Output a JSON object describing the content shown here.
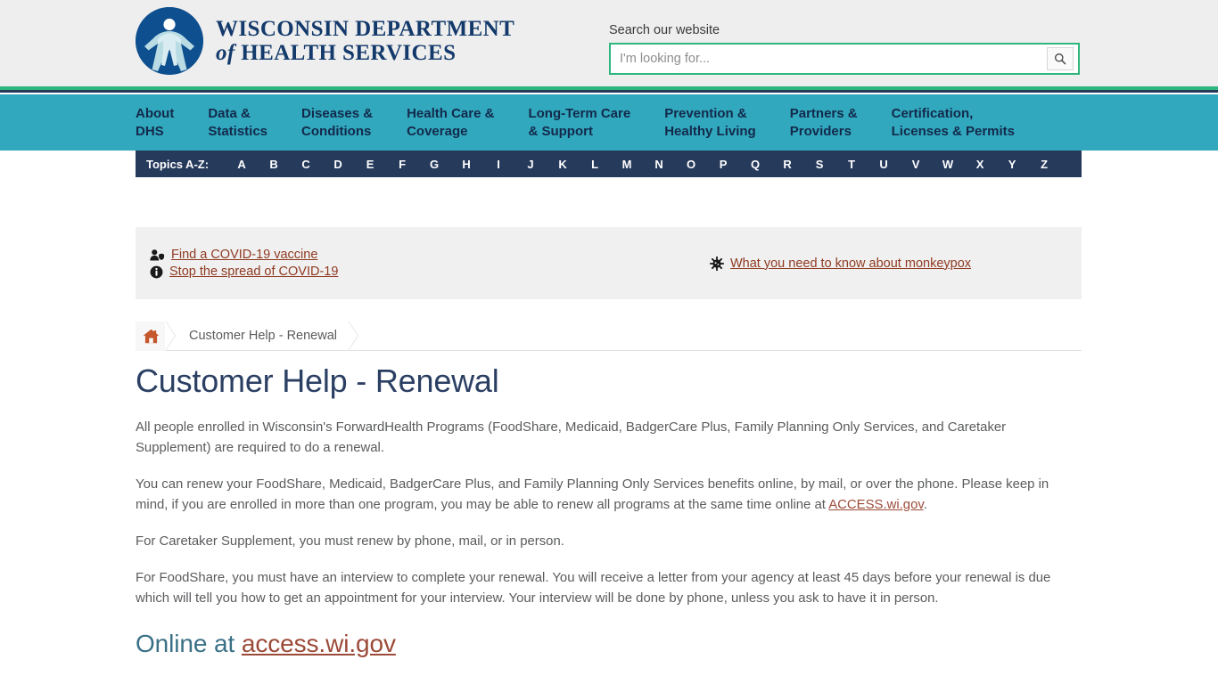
{
  "header": {
    "logo_alt": "Wisconsin Department of Health Services logo",
    "brand_line1": "WISCONSIN DEPARTMENT",
    "brand_of": "of",
    "brand_line2": "HEALTH SERVICES",
    "accent_green": "#2eb67d",
    "brand_navy": "#133a6b"
  },
  "search": {
    "label": "Search our website",
    "placeholder": "I'm looking for...",
    "value": "",
    "button_icon": "search-icon",
    "border_color": "#2eb67d"
  },
  "mainnav": {
    "background": "#31a8bd",
    "text_color": "#13294b",
    "items": [
      {
        "label": "About\nDHS"
      },
      {
        "label": "Data &\nStatistics"
      },
      {
        "label": "Diseases &\nConditions"
      },
      {
        "label": "Health Care &\nCoverage"
      },
      {
        "label": "Long-Term Care\n& Support"
      },
      {
        "label": "Prevention &\nHealthy Living"
      },
      {
        "label": "Partners &\nProviders"
      },
      {
        "label": "Certification,\nLicenses & Permits"
      }
    ]
  },
  "topics": {
    "background": "#263a5c",
    "label": "Topics A-Z:",
    "letters": [
      "A",
      "B",
      "C",
      "D",
      "E",
      "F",
      "G",
      "H",
      "I",
      "J",
      "K",
      "L",
      "M",
      "N",
      "O",
      "P",
      "Q",
      "R",
      "S",
      "T",
      "U",
      "V",
      "W",
      "X",
      "Y",
      "Z"
    ]
  },
  "alerts": {
    "background": "#f0f0f0",
    "left": [
      {
        "icon": "person-shield-icon",
        "label": "Find a COVID-19 vaccine"
      },
      {
        "icon": "info-circle-icon",
        "label": "Stop the spread of COVID-19"
      }
    ],
    "right": [
      {
        "icon": "virus-icon",
        "label": "What you need to know about monkeypox"
      }
    ],
    "link_color": "#8f3a22"
  },
  "breadcrumb": {
    "home_icon": "home-icon",
    "home_icon_color": "#c4572b",
    "items": [
      {
        "label": "Customer Help - Renewal"
      }
    ]
  },
  "main": {
    "title": "Customer Help - Renewal",
    "title_color": "#2b3f63",
    "paragraphs": [
      {
        "text": "All people enrolled in Wisconsin's ForwardHealth Programs (FoodShare, Medicaid, BadgerCare Plus, Family Planning Only Services, and Caretaker Supplement) are required to do a renewal."
      },
      {
        "text_before": "You can renew your FoodShare, Medicaid, BadgerCare Plus, and Family Planning Only Services benefits online, by mail, or over the phone. Please keep in mind, if you are enrolled in more than one program, you may be able to renew all programs at the same time online at ",
        "link": "ACCESS.wi.gov",
        "text_after": "."
      },
      {
        "text": "For Caretaker Supplement, you must renew by phone, mail, or in person."
      },
      {
        "text": "For FoodShare, you must have an interview to complete your renewal. You will receive a letter from your agency at least 45 days before your renewal is due which will tell you how to get an appointment for your interview. Your interview will be done by phone, unless you ask to have it in person."
      }
    ],
    "subheading": {
      "prefix": "Online at ",
      "link": "access.wi.gov",
      "color": "#3b7186"
    }
  }
}
